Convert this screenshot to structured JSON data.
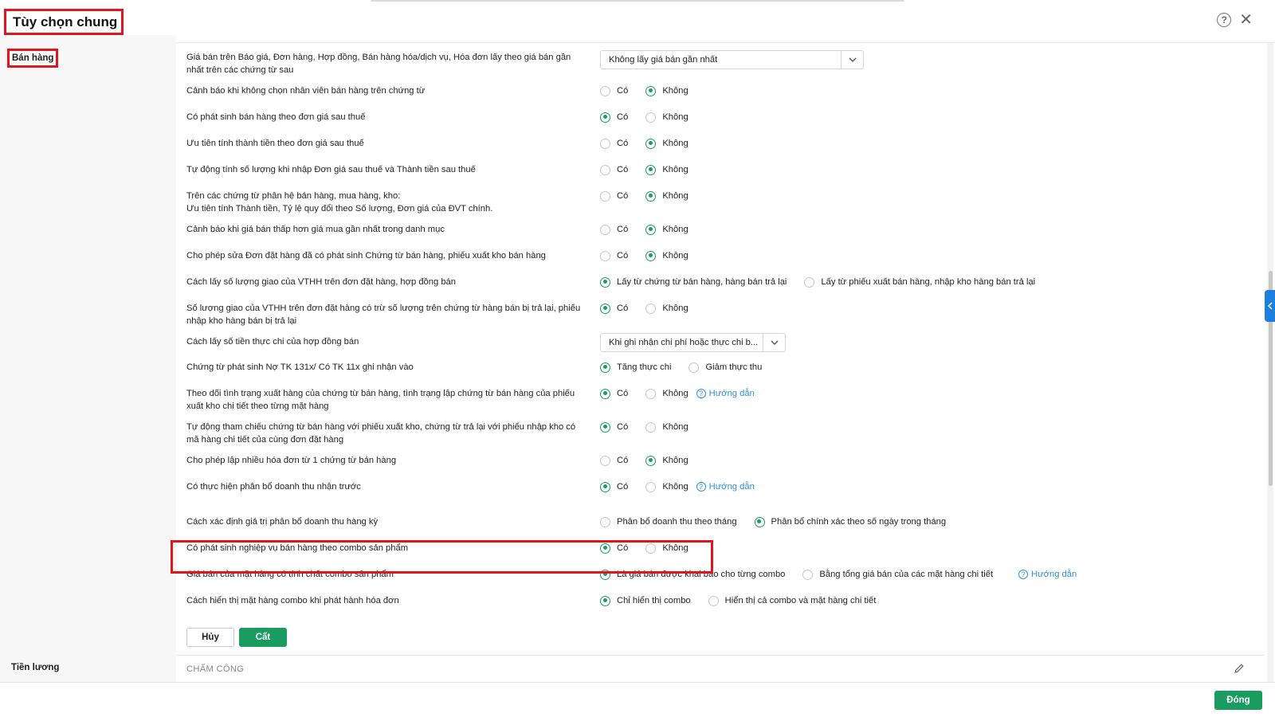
{
  "header": {
    "title": "Tùy chọn chung",
    "help_icon": "question-circle-icon",
    "close_icon": "close-icon",
    "close_symbol": "✕"
  },
  "sidebar": {
    "items": [
      {
        "label": "Bán hàng"
      },
      {
        "label": "Tiền lương"
      }
    ]
  },
  "settings": {
    "r1": {
      "label": "Giá bán trên Báo giá, Đơn hàng, Hợp đồng, Bán hàng hóa/dịch vụ, Hóa đơn lấy theo giá bán gần nhất trên các chứng từ sau",
      "select": "Không lấy giá bán gần nhất"
    },
    "r2": {
      "label": "Cảnh báo khi không chọn nhân viên bán hàng trên chứng từ",
      "o1": "Có",
      "o2": "Không"
    },
    "r3": {
      "label": "Có phát sinh bán hàng theo đơn giá sau thuế",
      "o1": "Có",
      "o2": "Không"
    },
    "r4": {
      "label": "Ưu tiên tính thành tiền theo đơn giá sau thuế",
      "o1": "Có",
      "o2": "Không"
    },
    "r5": {
      "label": "Tự động tính số lượng khi nhập Đơn giá sau thuế và Thành tiền sau thuế",
      "o1": "Có",
      "o2": "Không"
    },
    "r6": {
      "label": "Trên các chứng từ phân hệ bán hàng, mua hàng, kho:",
      "label2": "Ưu tiên tính Thành tiền, Tỷ lệ quy đổi theo Số lượng, Đơn giá của ĐVT chính.",
      "o1": "Có",
      "o2": "Không"
    },
    "r7": {
      "label": "Cảnh báo khi giá bán thấp hơn giá mua gần nhất trong danh mục",
      "o1": "Có",
      "o2": "Không"
    },
    "r8": {
      "label": "Cho phép sửa Đơn đặt hàng đã có phát sinh Chứng từ bán hàng, phiếu xuất kho bán hàng",
      "o1": "Có",
      "o2": "Không"
    },
    "r9": {
      "label": "Cách lấy số lượng giao của VTHH trên đơn đặt hàng, hợp đồng bán",
      "o1": "Lấy từ chứng từ bán hàng, hàng bán trả lại",
      "o2": "Lấy từ phiếu xuất bán hàng, nhập kho hàng bán trả lại"
    },
    "r10": {
      "label": "Số lượng giao của VTHH trên đơn đặt hàng có trừ số lượng trên chứng từ hàng bán bị trả lại, phiếu nhập kho hàng bán bị trả lại",
      "o1": "Có",
      "o2": "Không"
    },
    "r11": {
      "label": "Cách lấy số tiền thực chi của hợp đồng bán",
      "select": "Khi ghi nhận chi phí hoặc thực chi b..."
    },
    "r12": {
      "label": "Chứng từ phát sinh Nợ TK 131x/ Có TK 11x ghi nhận vào",
      "o1": "Tăng thực chi",
      "o2": "Giảm thực thu"
    },
    "r13": {
      "label": "Theo dõi tình trạng xuất hàng của chứng từ bán hàng, tình trạng lập chứng từ bán hàng của phiếu xuất kho chi tiết theo từng mặt hàng",
      "o1": "Có",
      "o2": "Không",
      "guide": "Hướng dẫn"
    },
    "r14": {
      "label": "Tự động tham chiếu chứng từ bán hàng với phiếu xuất kho, chứng từ trả lại với phiếu nhập kho có mã hàng chi tiết của cùng đơn đặt hàng",
      "o1": "Có",
      "o2": "Không"
    },
    "r15": {
      "label": "Cho phép lập nhiều hóa đơn từ 1 chứng từ bán hàng",
      "o1": "Có",
      "o2": "Không"
    },
    "r16": {
      "label": "Có thực hiện phân bổ doanh thu nhận trước",
      "o1": "Có",
      "o2": "Không",
      "guide": "Hướng dẫn"
    },
    "r17": {
      "label": "Cách xác định giá trị phân bổ doanh thu hàng kỳ",
      "o1": "Phân bổ doanh thu theo tháng",
      "o2": "Phân bổ chính xác theo số ngày trong tháng"
    },
    "r18": {
      "label": "Có phát sinh nghiệp vụ bán hàng theo combo sản phẩm",
      "o1": "Có",
      "o2": "Không"
    },
    "r19": {
      "label": "Giá bán của mặt hàng có tính chất combo sản phẩm",
      "o1": "Là giá bán được khai báo cho từng combo",
      "o2": "Bằng tổng giá bán của các mặt hàng chi tiết",
      "guide": "Hướng dẫn"
    },
    "r20": {
      "label": "Cách hiển thị mặt hàng combo khi phát hành hóa đơn",
      "o1": "Chỉ hiển thị combo",
      "o2": "Hiển thị cả combo và mặt hàng chi tiết"
    }
  },
  "actions": {
    "cancel": "Hủy",
    "save": "Cất"
  },
  "section": {
    "title": "CHẤM CÔNG",
    "edit_icon": "pencil-icon"
  },
  "footer": {
    "close": "Đóng"
  },
  "colors": {
    "accent": "#1a9b5f",
    "highlight": "#e0161e",
    "link": "#2f8fd6"
  }
}
